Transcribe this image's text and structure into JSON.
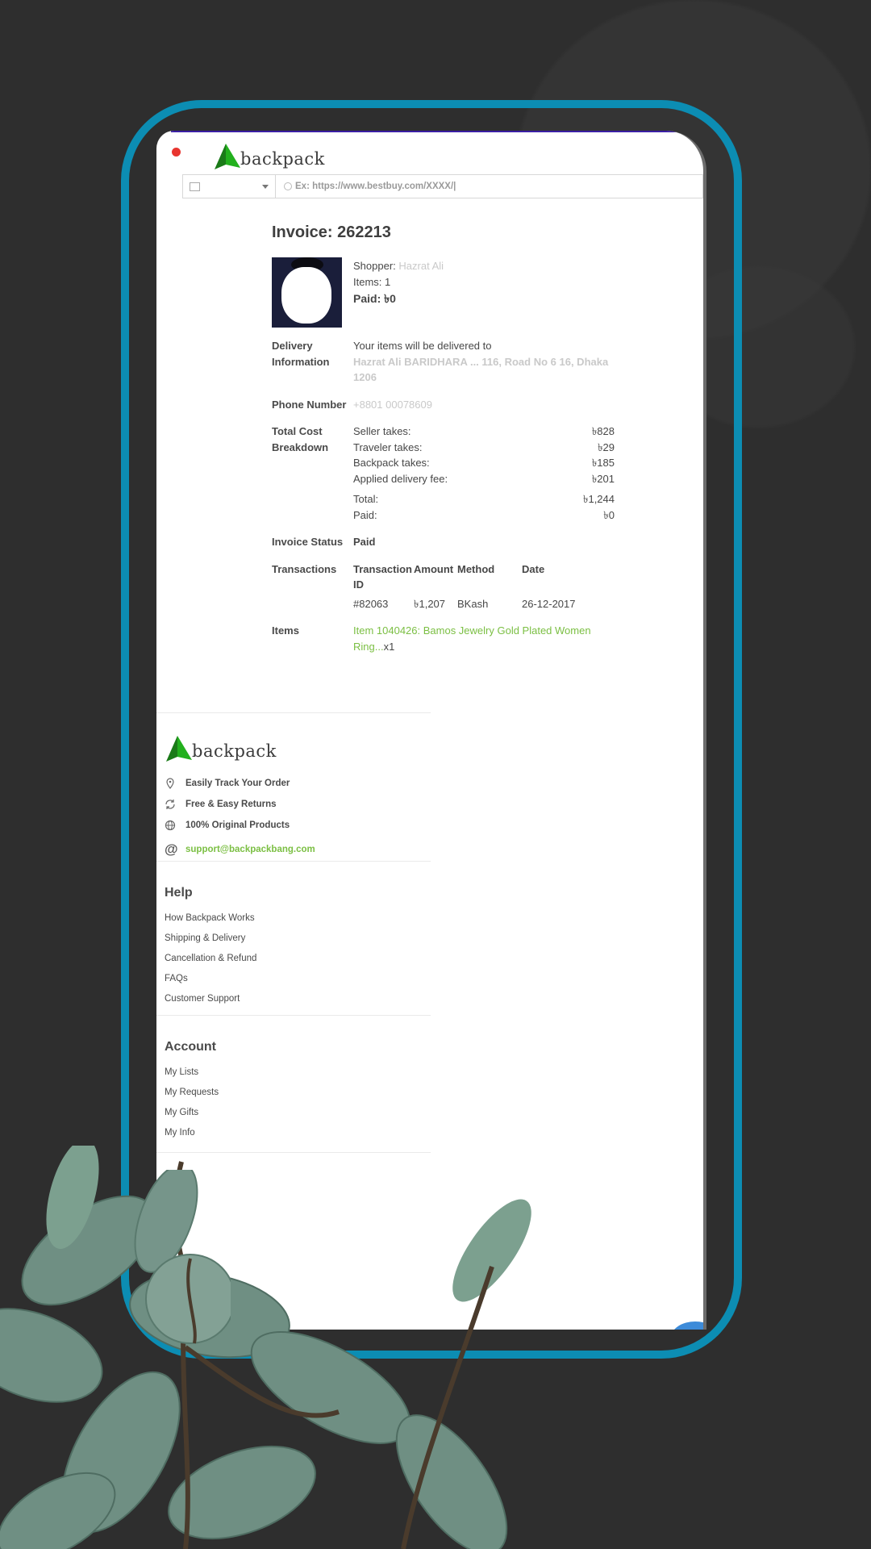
{
  "brand": {
    "name": "backpack",
    "logo_color": "#1ea51a"
  },
  "header": {
    "close_icon": "close-dot-icon",
    "country_flag": "flag-icon",
    "search_placeholder": "Ex: https://www.bestbuy.com/XXXX/|"
  },
  "invoice": {
    "title": "Invoice: 262213",
    "shopper_label": "Shopper:",
    "shopper_name": "Hazrat Ali",
    "items_count": "Items: 1",
    "paid_summary": "Paid: ৳0",
    "delivery_label": "Delivery Information",
    "delivery_intro": "Your items will be delivered to",
    "delivery_name": "Hazrat Ali",
    "delivery_address_1": "BARIDHARA ... 116, Road No 6 16, Dhaka",
    "delivery_address_2": "1206",
    "phone_label": "Phone Number",
    "phone_value": "+8801 00078609",
    "cost_label": "Total Cost Breakdown",
    "costs": [
      {
        "label": "Seller takes:",
        "value": "৳828"
      },
      {
        "label": "Traveler takes:",
        "value": "৳29"
      },
      {
        "label": "Backpack takes:",
        "value": "৳185"
      },
      {
        "label": "Applied delivery fee:",
        "value": "৳201"
      }
    ],
    "totals": [
      {
        "label": "Total:",
        "value": "৳1,244"
      },
      {
        "label": "Paid:",
        "value": "৳0"
      }
    ],
    "status_label": "Invoice Status",
    "status_value": "Paid",
    "transactions_label": "Transactions",
    "tx_headers": [
      "Transaction ID",
      "Amount",
      "Method",
      "Date"
    ],
    "tx_rows": [
      {
        "id": "#82063",
        "amount": "৳1,207",
        "method": "BKash",
        "date": "26-12-2017"
      }
    ],
    "items_label": "Items",
    "item_link": "Item 1040426: Bamos Jewelry Gold Plated Women Ring...",
    "item_qty": "x1"
  },
  "footer": {
    "features": [
      {
        "icon": "location-pin-icon",
        "label": "Easily Track Your Order"
      },
      {
        "icon": "refresh-icon",
        "label": "Free & Easy Returns"
      },
      {
        "icon": "globe-icon",
        "label": "100% Original Products"
      }
    ],
    "support_email": "support@backpackbang.com",
    "help_title": "Help",
    "help_links": [
      "How Backpack Works",
      "Shipping & Delivery",
      "Cancellation & Refund",
      "FAQs",
      "Customer Support"
    ],
    "account_title": "Account",
    "account_links": [
      "My Lists",
      "My Requests",
      "My Gifts",
      "My Info"
    ]
  },
  "colors": {
    "accent": "#7bbf43",
    "frame": "#0c8db3",
    "background": "#2e2e2e"
  }
}
